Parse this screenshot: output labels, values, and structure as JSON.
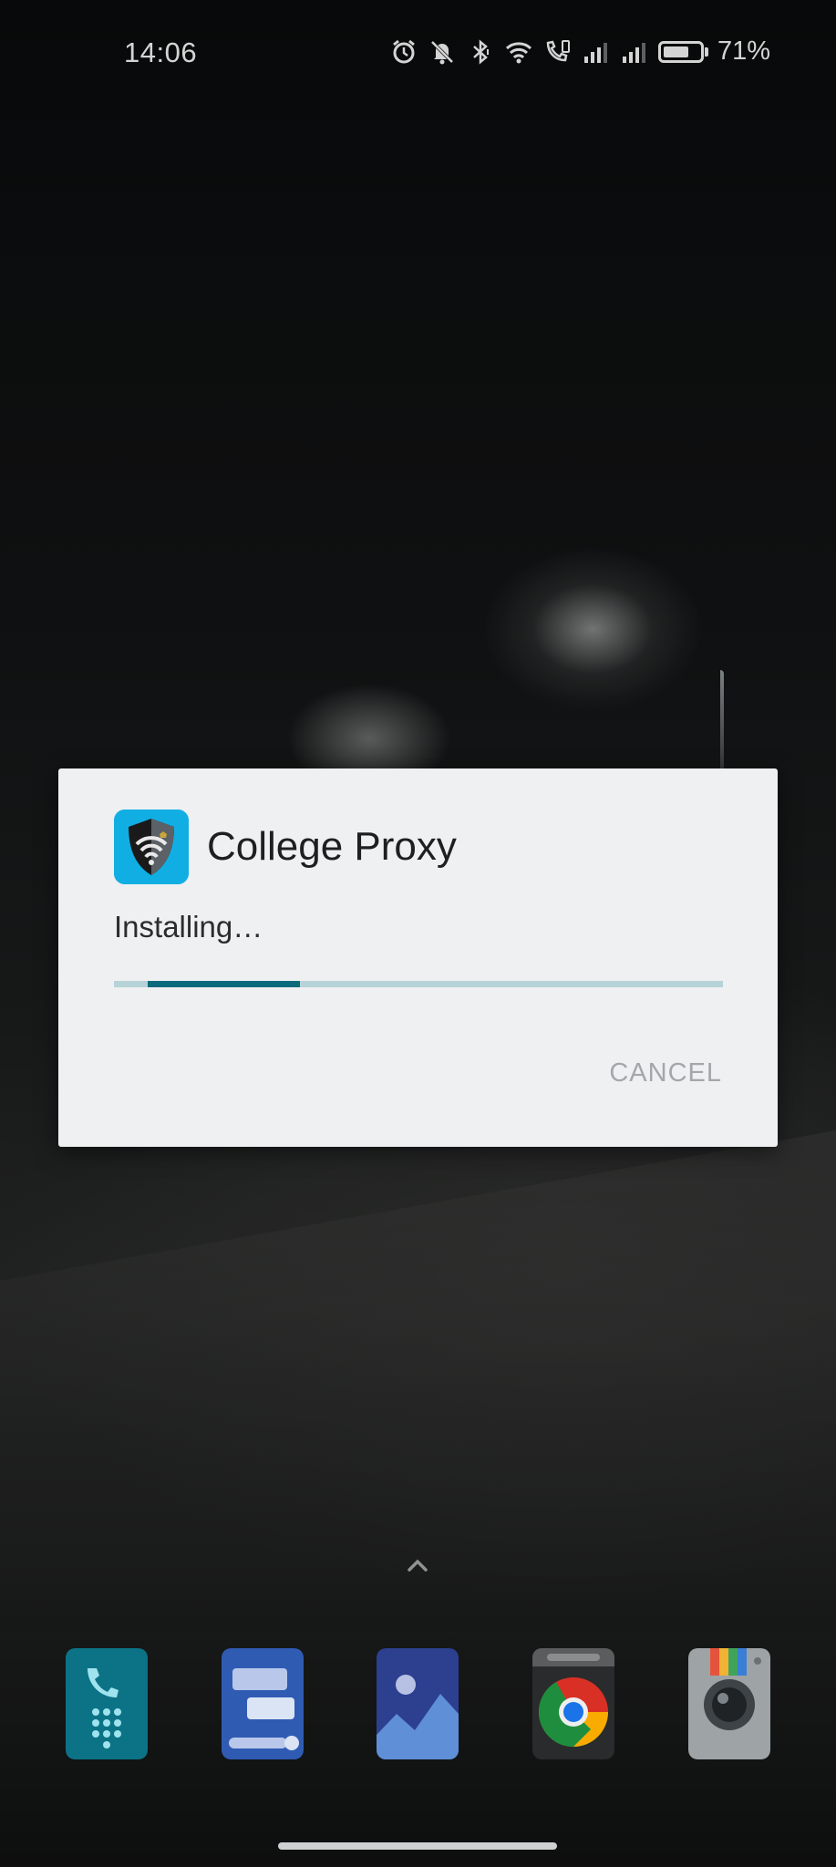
{
  "status_bar": {
    "time": "14:06",
    "battery_percent": "71%",
    "battery_level": 0.71,
    "icons": [
      "alarm-icon",
      "mute-icon",
      "bluetooth-icon",
      "wifi-icon",
      "volte-call-icon",
      "signal-1-icon",
      "signal-2-icon",
      "battery-icon"
    ]
  },
  "dialog": {
    "app_name": "College Proxy",
    "status_text": "Installing…",
    "progress": {
      "indeterminate": true,
      "segment_start": 0.055,
      "segment_end": 0.305
    },
    "cancel_label": "CANCEL",
    "colors": {
      "background": "#eff0f2",
      "progress_track": "#b6d3d8",
      "progress_fill": "#0b6b7c",
      "cancel_text": "#a4a7aa"
    }
  },
  "home": {
    "dock_apps": [
      {
        "name": "Phone",
        "icon": "phone-icon"
      },
      {
        "name": "Messages",
        "icon": "messages-icon"
      },
      {
        "name": "Gallery",
        "icon": "gallery-icon"
      },
      {
        "name": "Chrome",
        "icon": "chrome-icon"
      },
      {
        "name": "Camera",
        "icon": "camera-icon"
      }
    ]
  }
}
